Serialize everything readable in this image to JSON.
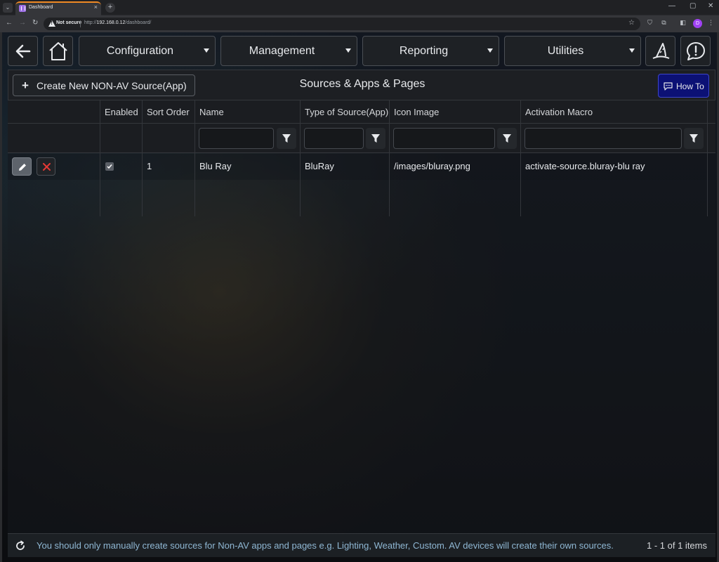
{
  "browser": {
    "tab_title": "Dashboard",
    "tab_close": "×",
    "new_tab": "+",
    "security_label": "Not secure",
    "url_prefix": "http://",
    "url_host": "192.168.0.12",
    "url_path": "/dashboard/"
  },
  "nav": {
    "menus": [
      "Configuration",
      "Management",
      "Reporting",
      "Utilities"
    ]
  },
  "panel": {
    "create_label": "Create New NON-AV Source(App)",
    "title": "Sources & Apps & Pages",
    "howto_label": "How To"
  },
  "grid": {
    "columns": [
      "Enabled",
      "Sort Order",
      "Name",
      "Type of Source(App)",
      "Icon Image",
      "Activation Macro"
    ],
    "rows": [
      {
        "enabled": true,
        "sort_order": "1",
        "name": "Blu Ray",
        "type": "BluRay",
        "icon_image": "/images/bluray.png",
        "activation_macro": "activate-source.bluray-blu ray"
      }
    ]
  },
  "footer": {
    "message": "You should only manually create sources for Non-AV apps and pages e.g. Lighting, Weather, Custom. AV devices will create their own sources.",
    "count": "1 - 1 of 1 items"
  },
  "colors": {
    "accent_tab": "#f08a24",
    "howto_bg": "#0c1175",
    "delete_icon": "#e53935",
    "footer_text": "#8fb7d3"
  }
}
